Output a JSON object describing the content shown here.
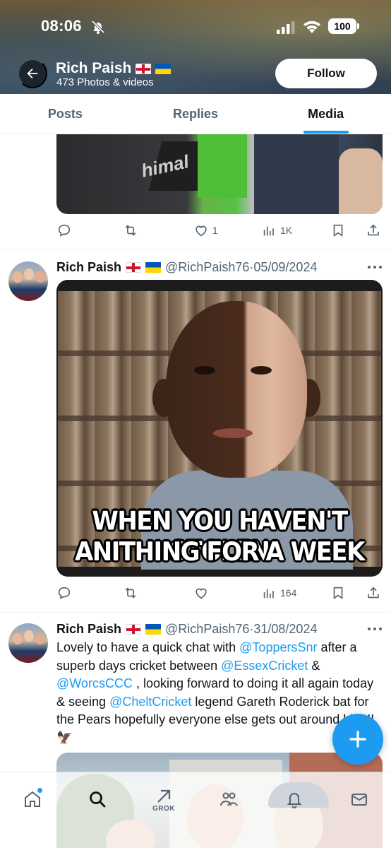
{
  "status_bar": {
    "time": "08:06",
    "battery": "100"
  },
  "profile": {
    "name": "Rich Paish",
    "media_count_label": "473 Photos & videos",
    "follow_label": "Follow"
  },
  "tabs": [
    {
      "label": "Posts",
      "active": false
    },
    {
      "label": "Replies",
      "active": false
    },
    {
      "label": "Media",
      "active": true
    }
  ],
  "tweets": [
    {
      "media_text": "himal",
      "stats": {
        "replies": "",
        "retweets": "",
        "likes": "1",
        "views": "1K"
      }
    },
    {
      "name": "Rich Paish",
      "handle": "@RichPaish76",
      "separator": "·",
      "date": "05/09/2024",
      "media_caption_line1": "WHEN YOU HAVEN'T STOLEN",
      "media_caption_line2": "ANITHING FOR A WEEK",
      "stats": {
        "replies": "",
        "retweets": "",
        "likes": "",
        "views": "164"
      }
    },
    {
      "name": "Rich Paish",
      "handle": "@RichPaish76",
      "separator": "·",
      "date": "31/08/2024",
      "text_parts": {
        "p1": "Lovely to have a quick chat with ",
        "m1": "@ToppersSnr",
        "p2": " after a superb days cricket between ",
        "m2": "@EssexCricket",
        "p3": " & ",
        "m3": "@WorcsCCC",
        "p4": " , looking forward to doing it all again today & seeing ",
        "m4": "@CheltCricket",
        "p5": " legend Gareth Roderick bat for the Pears hopefully everyone else gets out around him !! 🦅"
      }
    }
  ],
  "bottom_nav": {
    "items": [
      "home-icon",
      "search-icon",
      "grok-icon",
      "communities-icon",
      "notifications-icon",
      "messages-icon"
    ],
    "grok_label": "GROK"
  },
  "colors": {
    "accent": "#1d9bf0",
    "text": "#0f1419",
    "secondary": "#536471"
  }
}
